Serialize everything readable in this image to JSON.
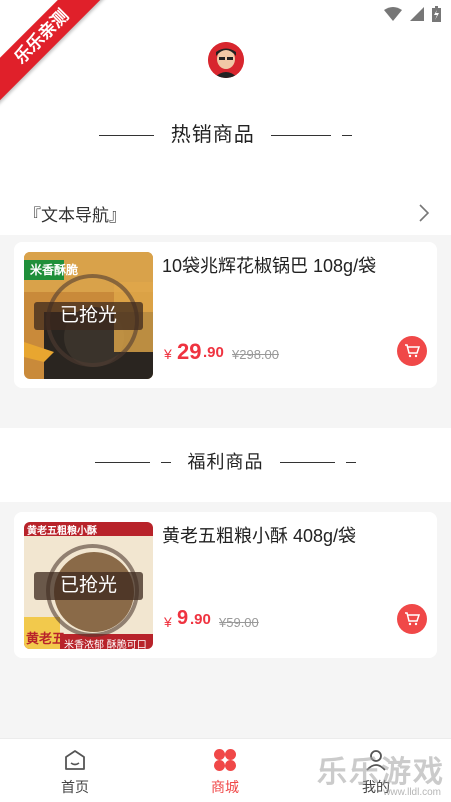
{
  "ribbon": {
    "text": "乐乐亲测"
  },
  "hot_section": {
    "title": "热销商品"
  },
  "nav": {
    "label": "『文本导航』"
  },
  "welfare_section": {
    "title": "福利商品"
  },
  "products_hot": [
    {
      "title": "10袋兆辉花椒锅巴 108g/袋",
      "badge": "已抢光",
      "thumb_text": "米香酥脆",
      "currency": "¥",
      "price_int": "29",
      "price_dec": ".90",
      "old_price": "¥298.00"
    }
  ],
  "products_welfare": [
    {
      "title": "黄老五粗粮小酥 408g/袋",
      "badge": "已抢光",
      "thumb_top": "黄老五粗粮小酥",
      "thumb_brand": "黄老五",
      "thumb_slogan": "米香浓郁 酥脆可口",
      "currency": "¥",
      "price_int": "9",
      "price_dec": ".90",
      "old_price": "¥59.00"
    }
  ],
  "tabbar": {
    "home": "首页",
    "mall": "商城",
    "mine": "我的"
  },
  "watermark": {
    "text": "乐乐游戏",
    "url": "www.lldl.com"
  },
  "colors": {
    "accent": "#ef3340",
    "ribbon": "#e0202a"
  }
}
